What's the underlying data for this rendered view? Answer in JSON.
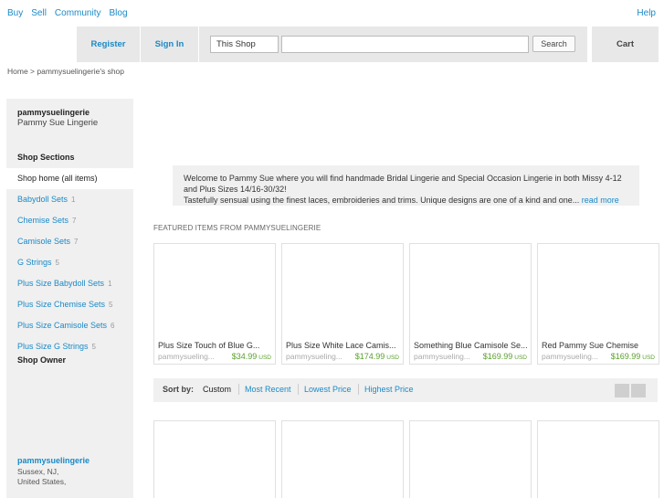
{
  "topnav": {
    "buy": "Buy",
    "sell": "Sell",
    "community": "Community",
    "blog": "Blog",
    "help": "Help"
  },
  "header": {
    "register": "Register",
    "signin": "Sign In",
    "scope": "This Shop",
    "search_button": "Search",
    "cart": "Cart"
  },
  "breadcrumb": "Home > pammysuelingerie's shop",
  "sidebar": {
    "username": "pammysuelingerie",
    "shop_name": "Pammy Sue Lingerie",
    "sections_heading": "Shop Sections",
    "items": [
      {
        "label": "Shop home (all items)",
        "count": ""
      },
      {
        "label": "Babydoll Sets",
        "count": "1"
      },
      {
        "label": "Chemise Sets",
        "count": "7"
      },
      {
        "label": "Camisole Sets",
        "count": "7"
      },
      {
        "label": "G Strings",
        "count": "5"
      },
      {
        "label": "Plus Size Babydoll Sets",
        "count": "1"
      },
      {
        "label": "Plus Size Chemise Sets",
        "count": "5"
      },
      {
        "label": "Plus Size Camisole Sets",
        "count": "6"
      },
      {
        "label": "Plus Size G Strings",
        "count": "5"
      }
    ],
    "owner_heading": "Shop Owner",
    "owner_name": "pammysuelingerie",
    "owner_location_1": "Sussex, NJ,",
    "owner_location_2": "United States,"
  },
  "welcome": {
    "line1": "Welcome to Pammy Sue where you will find handmade Bridal Lingerie and Special Occasion Lingerie in both Missy 4-12",
    "line2": "and Plus Sizes 14/16-30/32!",
    "line3": "Tastefully sensual using the finest laces, embroideries and trims. Unique designs are one of a kind and one...",
    "read_more": "read more"
  },
  "featured_heading": "FEATURED ITEMS FROM PAMMYSUELINGERIE",
  "featured": [
    {
      "title": "Plus Size Touch of Blue G...",
      "seller": "pammysueling...",
      "price": "$34.99",
      "currency": "USD"
    },
    {
      "title": "Plus Size White Lace Camis...",
      "seller": "pammysueling...",
      "price": "$174.99",
      "currency": "USD"
    },
    {
      "title": "Something Blue Camisole Se...",
      "seller": "pammysueling...",
      "price": "$169.99",
      "currency": "USD"
    },
    {
      "title": "Red Pammy Sue Chemise",
      "seller": "pammysueling...",
      "price": "$169.99",
      "currency": "USD"
    }
  ],
  "sort": {
    "label": "Sort by:",
    "options": [
      "Custom",
      "Most Recent",
      "Lowest Price",
      "Highest Price"
    ]
  }
}
